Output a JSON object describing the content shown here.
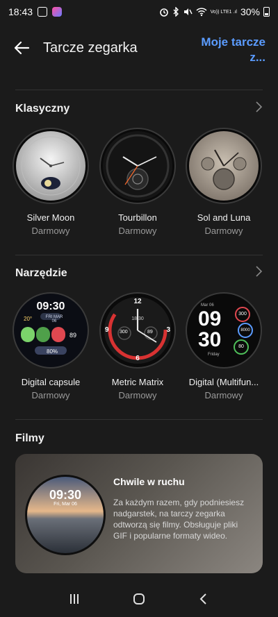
{
  "status_bar": {
    "time": "18:43",
    "lte_label": "Vo)) LTE1 .ıl",
    "battery": "30%"
  },
  "header": {
    "title": "Tarcze zegarka",
    "my_faces_link": "Moje tarcze z..."
  },
  "sections": {
    "classic": {
      "title": "Klasyczny",
      "items": [
        {
          "name": "Silver Moon",
          "price": "Darmowy"
        },
        {
          "name": "Tourbillon",
          "price": "Darmowy"
        },
        {
          "name": "Sol and Luna",
          "price": "Darmowy"
        }
      ]
    },
    "tools": {
      "title": "Narzędzie",
      "items": [
        {
          "name": "Digital capsule",
          "price": "Darmowy",
          "time": "09:30",
          "date": "FRI MAR 06",
          "temp": "20°",
          "heart": "89",
          "battery": "80%"
        },
        {
          "name": "Metric Matrix",
          "price": "Darmowy",
          "time": "18:30",
          "steps": "300",
          "heart": "89",
          "marks": [
            "12",
            "3",
            "6",
            "9"
          ]
        },
        {
          "name": "Digital (Multifun...",
          "price": "Darmowy",
          "hour": "09",
          "minute": "30",
          "date": "Mar 06",
          "day": "Friday",
          "steps": "300",
          "total": "8000",
          "heart": "80"
        }
      ]
    },
    "films": {
      "title": "Filmy",
      "card_title": "Chwile w ruchu",
      "card_desc": "Za każdym razem, gdy podniesiesz nadgarstek, na tarczy zegarka odtworzą się filmy. Obsługuje pliki GIF i popularne formaty wideo.",
      "face_time": "09:30",
      "face_date": "Fri, Mar 06"
    }
  },
  "colors": {
    "background": "#1b1b1b",
    "accent_link": "#5b9cff",
    "muted_text": "#9a9a9a"
  }
}
